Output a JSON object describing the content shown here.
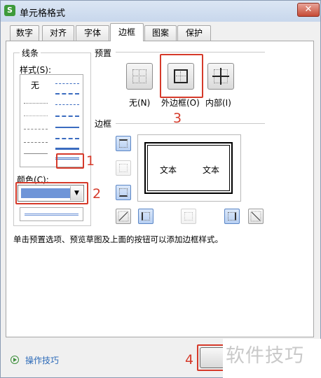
{
  "window": {
    "title": "单元格格式",
    "app_icon": "S",
    "close_glyph": "✕"
  },
  "tabs": [
    {
      "label": "数字"
    },
    {
      "label": "对齐"
    },
    {
      "label": "字体"
    },
    {
      "label": "边框",
      "active": true
    },
    {
      "label": "图案"
    },
    {
      "label": "保护"
    }
  ],
  "line_group": {
    "title": "线条",
    "style_label": "样式(S):",
    "none_label": "无",
    "color_label": "颜色(C):",
    "selected_color": "#6f95d8"
  },
  "presets": {
    "title": "预置",
    "none_label": "无(N)",
    "outline_label": "外边框(O)",
    "inside_label": "内部(I)"
  },
  "border_group": {
    "title": "边框",
    "preview_text_1": "文本",
    "preview_text_2": "文本"
  },
  "hint": "单击预置选项、预览草图及上面的按钮可以添加边框样式。",
  "footer": {
    "tips_label": "操作技巧",
    "ok_label": "确"
  },
  "annotations": {
    "n1": "1",
    "n2": "2",
    "n3": "3",
    "n4": "4",
    "color": "#d53a2a"
  },
  "watermark": "软件技巧"
}
